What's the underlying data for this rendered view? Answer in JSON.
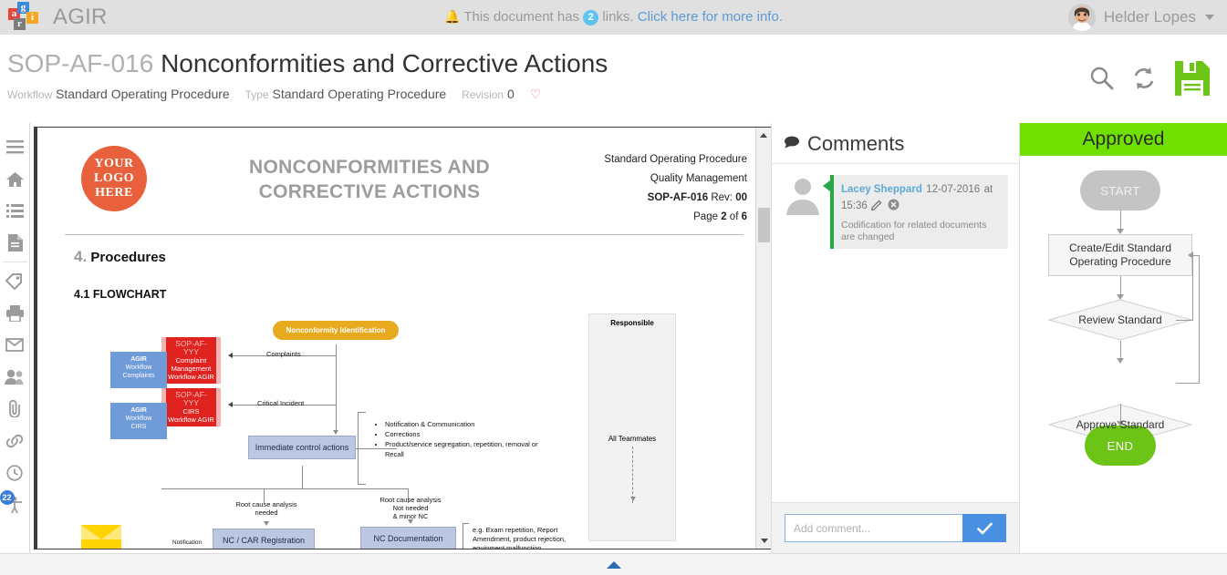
{
  "topbar": {
    "brand": "AGIR",
    "logo_tiles": [
      "a",
      "g",
      "r",
      "i"
    ],
    "banner_prefix": "This document has",
    "banner_count": "2",
    "banner_mid": "links.",
    "banner_link": "Click here for more info.",
    "user_name": "Helder Lopes"
  },
  "docheader": {
    "code": "SOP-AF-016",
    "title": "Nonconformities and Corrective Actions",
    "workflow_label": "Workflow",
    "workflow_value": "Standard Operating Procedure",
    "type_label": "Type",
    "type_value": "Standard Operating Procedure",
    "revision_label": "Revision",
    "revision_value": "0",
    "actions": [
      "search-icon",
      "refresh-icon",
      "save-icon"
    ]
  },
  "rail": {
    "items": [
      {
        "name": "menu-icon"
      },
      {
        "name": "home-icon"
      },
      {
        "name": "list-icon"
      },
      {
        "name": "document-icon"
      },
      {
        "name": "tag-icon"
      },
      {
        "name": "print-icon"
      },
      {
        "name": "mail-icon"
      },
      {
        "name": "users-icon"
      },
      {
        "name": "attachment-icon"
      },
      {
        "name": "link-icon"
      },
      {
        "name": "history-icon"
      },
      {
        "name": "accessibility-icon",
        "badge": "22"
      }
    ]
  },
  "document": {
    "logo_lines": [
      "YOUR",
      "LOGO",
      "HERE"
    ],
    "title_line1": "NONCONFORMITIES AND",
    "title_line2": "CORRECTIVE ACTIONS",
    "info_line1": "Standard Operating Procedure",
    "info_line2": "Quality Management",
    "info_code": "SOP-AF-016",
    "info_rev_label": "Rev:",
    "info_rev": "00",
    "info_page_label": "Page",
    "info_page": "2",
    "info_of": "of",
    "info_pages": "6",
    "section_num": "4.",
    "section_title": "Procedures",
    "subsection": "4.1  FLOWCHART",
    "flow": {
      "start_node": "Nonconformity Identification",
      "complaints_label": "Complaints",
      "critical_label": "Critical Incident",
      "red_box1_code": "SOP-AF-YYY",
      "red_box1_l1": "Complaint",
      "red_box1_l2": "Management",
      "red_box1_l3": "Workflow AGIR",
      "red_box2_code": "SOP-AF-YYY",
      "red_box2_l1": "CIRS",
      "red_box2_l3": "Workflow AGIR",
      "tag1_l1": "AGIR",
      "tag1_l2": "Workflow",
      "tag1_l3": "Complaints",
      "tag2_l1": "AGIR",
      "tag2_l2": "Workflow",
      "tag2_l3": "CIRS",
      "control_node": "Immediate control actions",
      "bullets": [
        "Notification & Communication",
        "Corrections",
        "Product/service segregation, repetition, removal or Recall"
      ],
      "branch_left_l1": "Root cause analysis",
      "branch_left_l2": "needed",
      "branch_right_l1": "Root cause analysis",
      "branch_right_l2": "Not needed",
      "branch_right_l3": "& minor NC",
      "node_car": "NC / CAR Registration",
      "node_ncdoc": "NC Documentation",
      "note_eg": "e.g. Exam repetition, Report Amendment, product rejection, equipment malfunction",
      "notification_label": "Notification",
      "responsible_header": "Responsible",
      "responsible_1": "All Teammates"
    }
  },
  "comments": {
    "title": "Comments",
    "items": [
      {
        "author": "Lacey Sheppard",
        "date": "12-07-2016",
        "time_prefix": "at",
        "time": "15:36",
        "text": "Codification for related documents are changed"
      }
    ],
    "input_placeholder": "Add comment...",
    "input_value": "",
    "send_label": "✔"
  },
  "workflow_panel": {
    "status": "Approved",
    "nodes": {
      "start": "START",
      "process": "Create/Edit Standard Operating Procedure",
      "review": "Review Standard",
      "approve": "Approve Standard",
      "end": "END"
    }
  },
  "footer": {
    "toggle": "collapse-panel-arrow"
  },
  "colors": {
    "accent_green": "#6fe000",
    "end_green": "#6cc417",
    "link_blue": "#5b9bd5",
    "badge_blue": "#5ec3ef",
    "orange": "#e8aa1e",
    "red": "#e0231f",
    "heart_pink": "#f06eaa"
  }
}
